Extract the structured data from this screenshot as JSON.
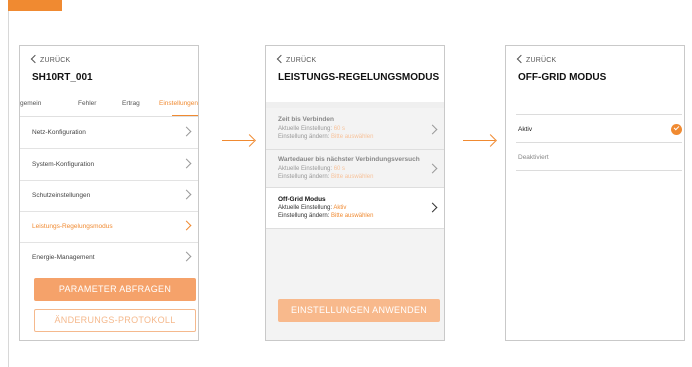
{
  "accent_color": "#f08a31",
  "screen1": {
    "back_label": "ZURÜCK",
    "title": "SH10RT_001",
    "tabs": [
      "gemein",
      "Fehler",
      "Ertrag",
      "Einstellungen"
    ],
    "menu_items": [
      {
        "label": "Netz-Konfiguration"
      },
      {
        "label": "System-Konfiguration"
      },
      {
        "label": "Schutzeinstellungen"
      },
      {
        "label": "Leistungs-Regelungsmodus"
      },
      {
        "label": "Energie-Management"
      }
    ],
    "primary_button": "PARAMETER ABFRAGEN",
    "secondary_button": "ÄNDERUNGS-PROTOKOLL"
  },
  "screen2": {
    "back_label": "ZURÜCK",
    "title": "LEISTUNGS-REGELUNGSMODUS",
    "settings": [
      {
        "name": "Zeit bis Verbinden",
        "current_prefix": "Aktuelle Einstellung:",
        "current_value": "60 s",
        "change_prefix": "Einstellung ändern:",
        "change_value": "Bitte auswählen"
      },
      {
        "name": "Wartedauer bis nächster Verbindungsversuch",
        "current_prefix": "Aktuelle Einstellung:",
        "current_value": "60 s",
        "change_prefix": "Einstellung ändern:",
        "change_value": "Bitte auswählen"
      },
      {
        "name": "Off-Grid Modus",
        "current_prefix": "Aktuelle Einstellung:",
        "current_value": "Aktiv",
        "change_prefix": "Einstellung ändern:",
        "change_value": "Bitte auswählen"
      }
    ],
    "apply_button": "EINSTELLUNGEN ANWENDEN"
  },
  "screen3": {
    "back_label": "ZURÜCK",
    "title": "OFF-GRID MODUS",
    "options": [
      {
        "label": "Aktiv",
        "selected": true
      },
      {
        "label": "Deaktiviert",
        "selected": false
      }
    ]
  }
}
